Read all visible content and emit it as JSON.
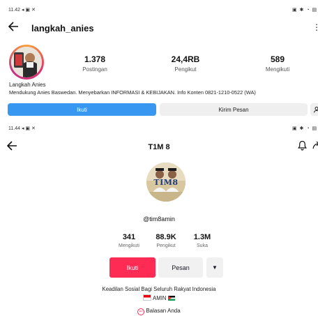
{
  "instagram": {
    "status_time": "11.42",
    "status_icons_left": "◂ ▣ ✕",
    "status_icons_right": "▣ ✱ ◔ ▤",
    "username": "langkah_anies",
    "stats": [
      {
        "value": "1.378",
        "label": "Postingan"
      },
      {
        "value": "24,4RB",
        "label": "Pengikut"
      },
      {
        "value": "589",
        "label": "Mengikuti"
      }
    ],
    "display_name": "Langkah Anies",
    "bio": "Mendukung Anies Baswedan. Menyebarkan INFORMASI & KEBIJAKAN. Info Konten 0821-1210-0522 (WA)",
    "follow_label": "Ikuti",
    "message_label": "Kirim Pesan",
    "accent": "#3897f0"
  },
  "tiktok": {
    "status_time": "11.44",
    "status_icons_left": "◂ ▣ ✕",
    "status_icons_right": "▣ ✱ ◔ ▤",
    "title": "T1M 8",
    "avatar_text": "TIM8",
    "handle": "@tim8amin",
    "stats": [
      {
        "value": "341",
        "label": "Mengikuti"
      },
      {
        "value": "88.9K",
        "label": "Pengikut"
      },
      {
        "value": "1.3M",
        "label": "Suka"
      }
    ],
    "follow_label": "Ikuti",
    "message_label": "Pesan",
    "bio_line1": "Keadilan Sosial Bagi Seluruh Rakyat Indonesia",
    "bio_line2": "AMIN",
    "reply_label": "Balasan Anda",
    "accent": "#fe2c55"
  }
}
